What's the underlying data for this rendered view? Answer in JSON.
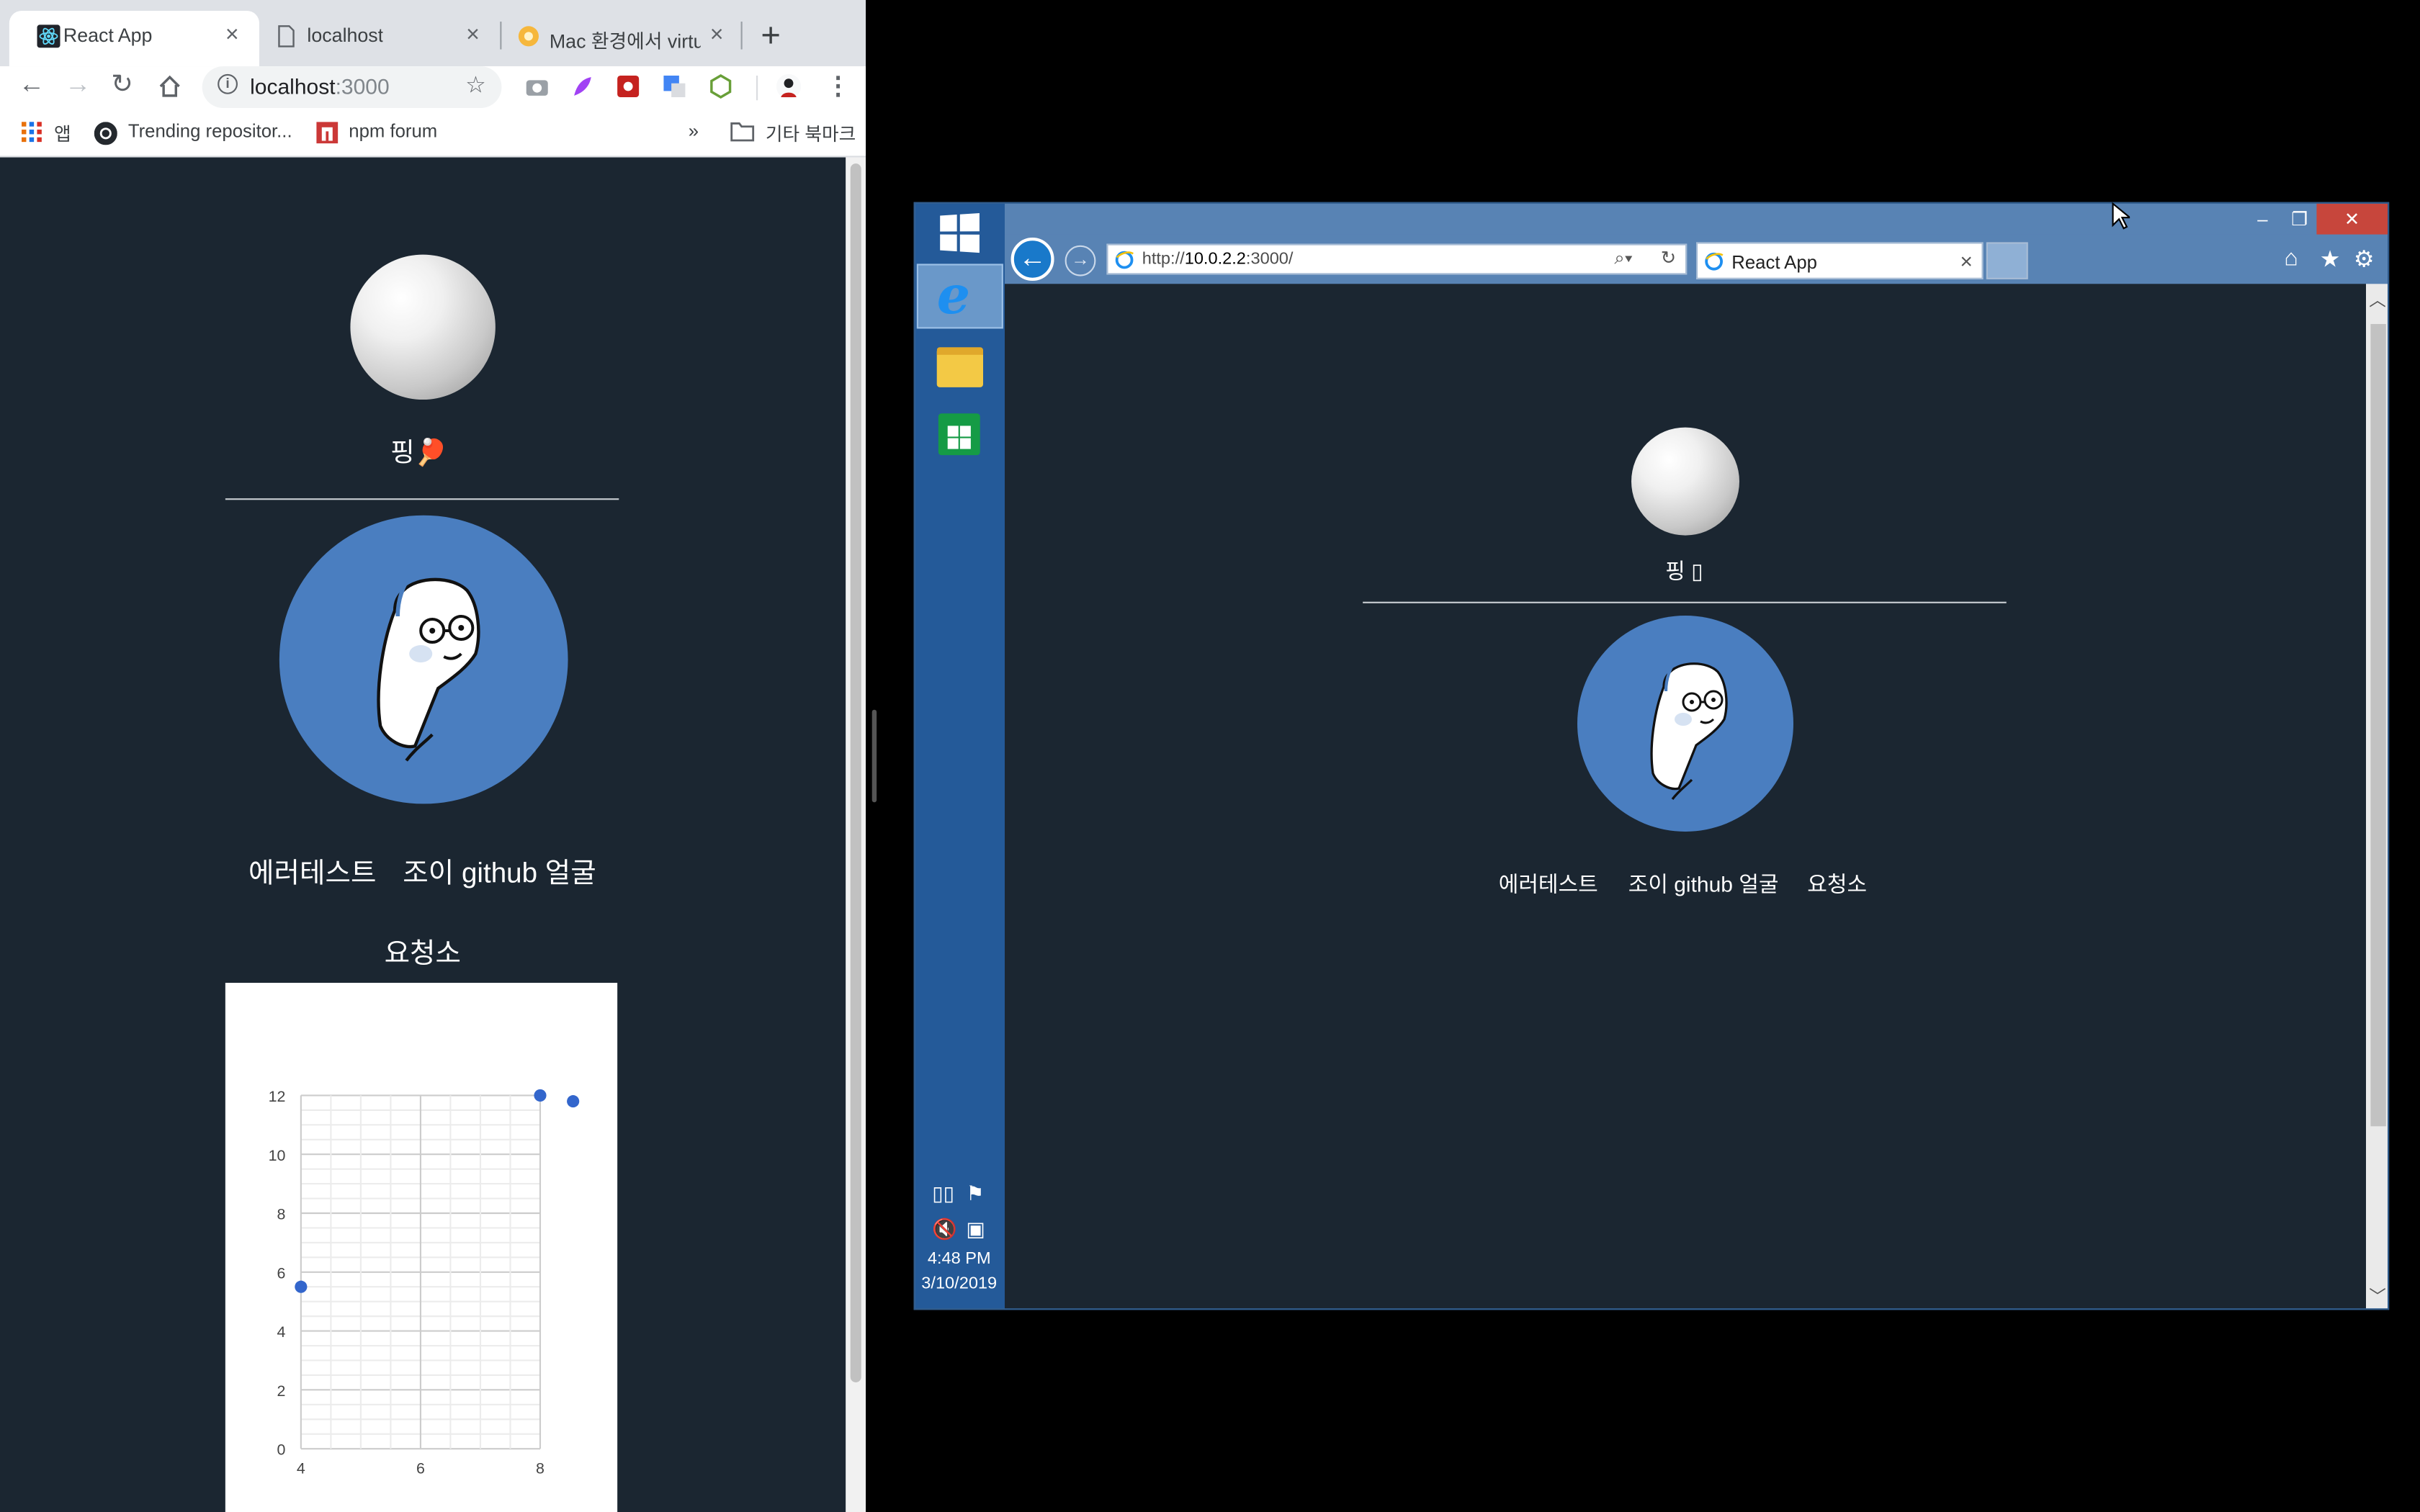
{
  "chrome": {
    "tabs": [
      {
        "title": "React App",
        "close": "×"
      },
      {
        "title": "localhost",
        "close": "×"
      },
      {
        "title": "Mac 환경에서 virtua",
        "close": "×"
      }
    ],
    "new_tab": "+",
    "url_host": "localhost",
    "url_port": ":3000",
    "bookmarks": {
      "apps": "앱",
      "trending": "Trending repositor...",
      "npm": "npm forum",
      "more": "»",
      "other": "기타 북마크"
    }
  },
  "app": {
    "ping_label": "핑🏓",
    "ping_label_ie": "핑 ▯",
    "nav_error_test": "에러테스트",
    "nav_github": "조이 github 얼굴",
    "nav_yocheongso": "요청소"
  },
  "chart_data": {
    "type": "scatter",
    "x_ticks": [
      "4",
      "6",
      "8"
    ],
    "y_ticks": [
      "0",
      "2",
      "4",
      "6",
      "8",
      "10",
      "12"
    ],
    "xlim": [
      4,
      8
    ],
    "ylim": [
      0,
      12
    ],
    "grid": true,
    "points": [
      {
        "x": 4,
        "y": 5.5
      },
      {
        "x": 8,
        "y": 12
      },
      {
        "x": 8.55,
        "y": 11.8
      }
    ],
    "color": "#3366cc"
  },
  "vm": {
    "address": "http://10.0.2.2:3000/",
    "address_prefix": "http://",
    "address_host": "10.0.2.2",
    "address_suffix": ":3000/",
    "tab_title": "React App",
    "tab_close": "×",
    "time": "4:48 PM",
    "date": "3/10/2019"
  },
  "colors": {
    "page_bg": "#1b2631",
    "avatar_bg": "#4a7ec0",
    "win_chrome": "#5883b4",
    "charms": "#245a99"
  }
}
